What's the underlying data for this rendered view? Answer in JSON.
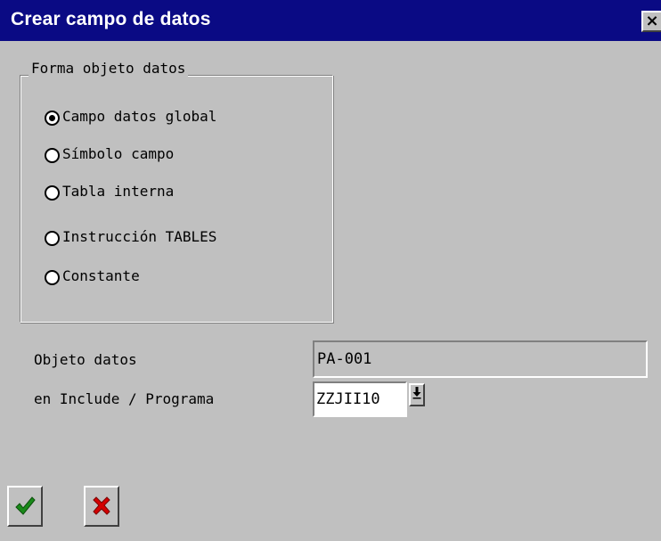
{
  "window": {
    "title": "Crear campo de datos",
    "close_glyph": "×"
  },
  "group": {
    "legend": "Forma objeto datos",
    "options": [
      {
        "label": "Campo datos global",
        "selected": true
      },
      {
        "label": "Símbolo campo",
        "selected": false
      },
      {
        "label": "Tabla interna",
        "selected": false
      },
      {
        "label": "Instrucción TABLES",
        "selected": false
      },
      {
        "label": "Constante",
        "selected": false
      }
    ]
  },
  "fields": {
    "data_object_label": "Objeto datos",
    "data_object_value": "PA-001",
    "include_label": "en Include / Programa",
    "include_value": "ZZJII10"
  },
  "buttons": {
    "ok_icon": "checkmark-icon",
    "cancel_icon": "cross-icon"
  },
  "colors": {
    "titlebar": "#0a0a84",
    "dialog_bg": "#c0c0c0",
    "ok_green": "#1a8a1a",
    "cancel_red": "#d40000"
  }
}
